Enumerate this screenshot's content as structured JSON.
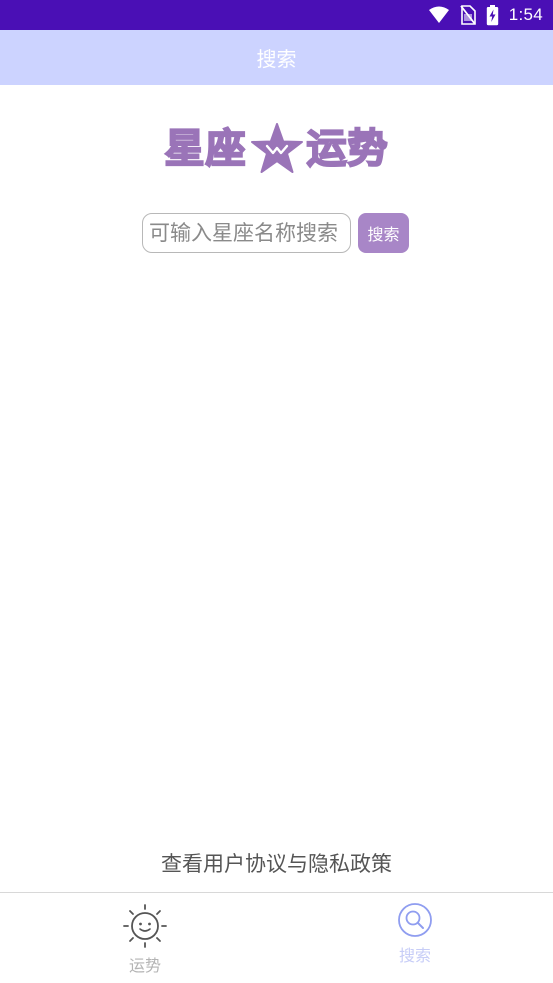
{
  "status_bar": {
    "time": "1:54",
    "icons": [
      "wifi-icon",
      "no-sim-icon",
      "battery-charging-icon"
    ]
  },
  "header": {
    "title": "搜索"
  },
  "logo": {
    "left_text": "星座",
    "right_text": "运势",
    "icon": "star-icon"
  },
  "search": {
    "placeholder": "可输入星座名称搜索",
    "value": "",
    "button_label": "搜索"
  },
  "footer_link": {
    "label": "查看用户协议与隐私政策"
  },
  "bottom_nav": {
    "items": [
      {
        "label": "运势",
        "icon": "sun-face-icon",
        "selected": false
      },
      {
        "label": "搜索",
        "icon": "search-icon",
        "selected": true
      }
    ]
  },
  "colors": {
    "status_bar": "#4a0fb5",
    "header": "#ccd3ff",
    "accent": "#a886c7",
    "nav_active": "#c7cdf7"
  }
}
